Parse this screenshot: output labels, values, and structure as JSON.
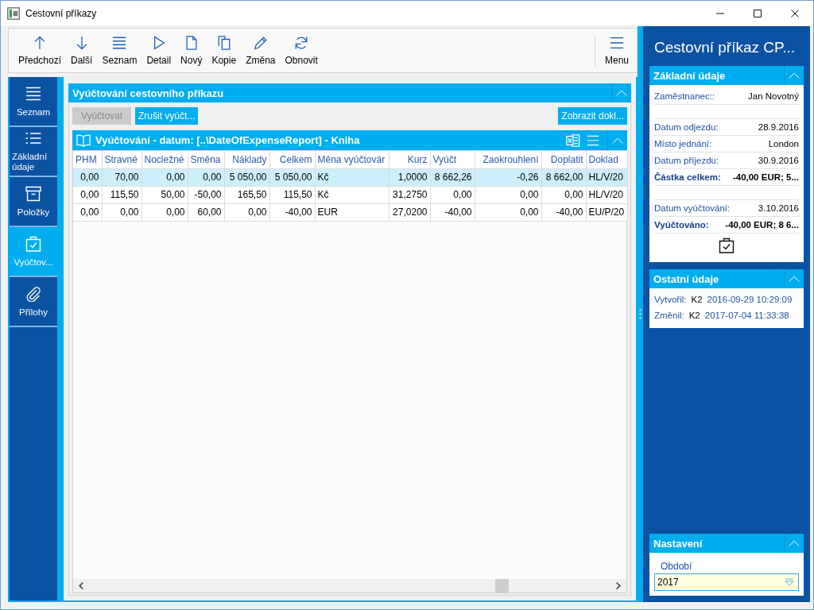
{
  "window": {
    "title": "Cestovní příkazy"
  },
  "toolbar": {
    "buttons": [
      {
        "kind": "up",
        "label": "Předchozí"
      },
      {
        "kind": "down",
        "label": "Další"
      },
      {
        "kind": "list",
        "label": "Seznam"
      },
      {
        "kind": "play",
        "label": "Detail"
      },
      {
        "kind": "document",
        "label": "Nový"
      },
      {
        "kind": "copy",
        "label": "Kopie"
      },
      {
        "kind": "pencil",
        "label": "Změna"
      },
      {
        "kind": "refresh",
        "label": "Obnovit"
      }
    ],
    "menu": {
      "label": "Menu"
    }
  },
  "nav": {
    "items": [
      {
        "kind": "list",
        "label": "Seznam",
        "selected": false
      },
      {
        "kind": "bullets",
        "label": "Základní údaje",
        "selected": false
      },
      {
        "kind": "box",
        "label": "Položky",
        "selected": false
      },
      {
        "kind": "clipboard",
        "label": "Vyúčtov...",
        "selected": true
      },
      {
        "kind": "paperclip",
        "label": "Přílohy",
        "selected": false
      }
    ]
  },
  "section": {
    "title": "Vyúčtování cestovního příkazu",
    "expanded": true,
    "buttons": [
      {
        "label": "Vyúčtovat",
        "disabled": true
      },
      {
        "label": "Zrušit vyúčt...",
        "disabled": false
      }
    ],
    "right_button": {
      "label": "Zobrazit dokl..."
    }
  },
  "grid": {
    "title": "Vyúčtování - datum: [..\\DateOfExpenseReport] - Kniha",
    "expanded": true,
    "columns": [
      "PHM",
      "Stravné",
      "Nocležné",
      "Směna",
      "Náklady",
      "Celkem",
      "Měna vyúčtovár",
      "Kurz",
      "Vyúčt",
      "Zaokrouhlení",
      "Doplatit",
      "Doklad"
    ],
    "rows": [
      {
        "selected": true,
        "cells": [
          "0,00",
          "70,00",
          "0,00",
          "0,00",
          "5 050,00",
          "5 050,00",
          "Kč",
          "1,0000",
          "8 662,26",
          "-0,26",
          "8 662,00",
          "HL/V/20"
        ]
      },
      {
        "selected": false,
        "cells": [
          "0,00",
          "115,50",
          "50,00",
          "-50,00",
          "165,50",
          "115,50",
          "Kč",
          "31,2750",
          "0,00",
          "0,00",
          "0,00",
          "HL/V/20"
        ]
      },
      {
        "selected": false,
        "cells": [
          "0,00",
          "0,00",
          "0,00",
          "60,00",
          "0,00",
          "-40,00",
          "EUR",
          "27,0200",
          "-40,00",
          "0,00",
          "-40,00",
          "EU/P/20"
        ]
      }
    ]
  },
  "detail": {
    "title": "Cestovní příkaz CP...",
    "cards": [
      {
        "kind": "fields",
        "title": "Základní údaje",
        "expanded": true,
        "rows": [
          {
            "kind": "field",
            "label": "Zaměstnanec::",
            "value": "Jan Novotný"
          },
          {
            "kind": "blank"
          },
          {
            "kind": "field",
            "label": "Datum odjezdu:",
            "value": "28.9.2016"
          },
          {
            "kind": "field",
            "label": "Místo jednání:",
            "value": "London"
          },
          {
            "kind": "field",
            "label": "Datum příjezdu:",
            "value": "30.9.2016"
          },
          {
            "kind": "total",
            "label": "Částka celkem:",
            "value": "-40,00 EUR; 5..."
          },
          {
            "kind": "blank"
          },
          {
            "kind": "field",
            "label": "Datum vyúčtování:",
            "value": "3.10.2016"
          },
          {
            "kind": "total",
            "label": "Vyúčtováno:",
            "value": "-40,00 EUR; 8 6..."
          },
          {
            "kind": "icon"
          }
        ]
      },
      {
        "kind": "audit",
        "title": "Ostatní údaje",
        "expanded": true,
        "rows": [
          {
            "label": "Vytvořil:",
            "user": "K2",
            "time": "2016-09-29 10:29:09"
          },
          {
            "label": "Změnil:",
            "user": "K2",
            "time": "2017-07-04 11:33:38"
          }
        ]
      },
      {
        "kind": "settings",
        "title": "Nastavení",
        "expanded": true,
        "field": {
          "label": "Období",
          "value": "2017"
        }
      }
    ]
  }
}
